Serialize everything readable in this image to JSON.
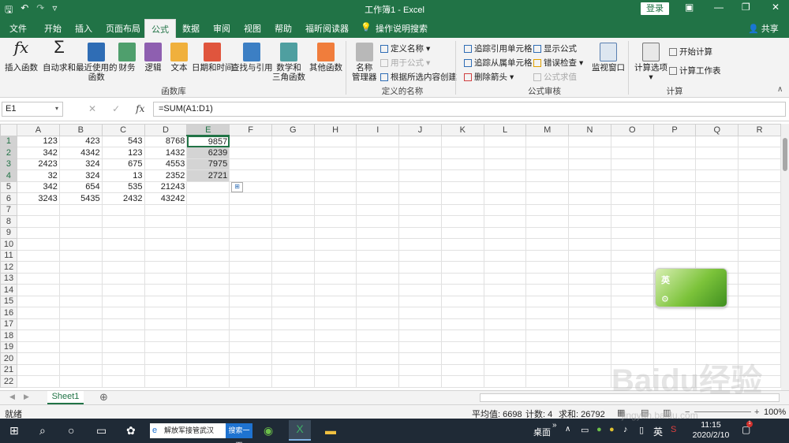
{
  "titlebar": {
    "title": "工作簿1  -  Excel",
    "login": "登录"
  },
  "tabs": [
    "文件",
    "开始",
    "插入",
    "页面布局",
    "公式",
    "数据",
    "审阅",
    "视图",
    "帮助",
    "福昕阅读器"
  ],
  "active_tab": "公式",
  "tellme": "操作说明搜索",
  "share": "共享",
  "ribbon": {
    "insert_function": "插入函数",
    "autosum": "自动求和",
    "recent": "最近使用的",
    "recent2": "函数",
    "financial": "财务",
    "logical": "逻辑",
    "text": "文本",
    "datetime": "日期和时间",
    "lookup": "查找与引用",
    "math1": "数学和",
    "math2": "三角函数",
    "other": "其他函数",
    "group_library": "函数库",
    "name_manager1": "名称",
    "name_manager2": "管理器",
    "define_name": "定义名称",
    "use_in_formula": "用于公式",
    "create_from_selection": "根据所选内容创建",
    "group_names": "定义的名称",
    "trace_precedents": "追踪引用单元格",
    "trace_dependents": "追踪从属单元格",
    "remove_arrows": "删除箭头",
    "show_formulas": "显示公式",
    "error_checking": "错误检查",
    "evaluate_formula": "公式求值",
    "watch_window": "监视窗口",
    "group_audit": "公式审核",
    "calc_options": "计算选项",
    "calc_now": "开始计算",
    "calc_sheet": "计算工作表",
    "group_calc": "计算"
  },
  "formula_bar": {
    "name_box": "E1",
    "formula": "=SUM(A1:D1)",
    "fx": "fx"
  },
  "columns": [
    "A",
    "B",
    "C",
    "D",
    "E",
    "F",
    "G",
    "H",
    "I",
    "J",
    "K",
    "L",
    "M",
    "N",
    "O",
    "P",
    "Q",
    "R"
  ],
  "rows": [
    [
      "123",
      "423",
      "543",
      "8768",
      "9857"
    ],
    [
      "342",
      "4342",
      "123",
      "1432",
      "6239"
    ],
    [
      "2423",
      "324",
      "675",
      "4553",
      "7975"
    ],
    [
      "32",
      "324",
      "13",
      "2352",
      "2721"
    ],
    [
      "342",
      "654",
      "535",
      "21243",
      ""
    ],
    [
      "3243",
      "5435",
      "2432",
      "43242",
      ""
    ]
  ],
  "row_count": 22,
  "sheet_tab": "Sheet1",
  "status": {
    "ready": "就绪",
    "average": "平均值: 6698",
    "count": "计数: 4",
    "sum": "求和: 26792",
    "zoom": "100%"
  },
  "taskbar": {
    "search_text": "解放军接管武汉",
    "search_button": "搜索一下",
    "desktop": "桌面",
    "ime": "英",
    "time": "11:15",
    "date": "2020/2/10"
  },
  "ime_widget": "英",
  "watermark": "Baidu经验",
  "watermark_url": "jingyan.baidu.com",
  "colors": {
    "excel_green": "#217346",
    "selection_gray": "#d4d4d4",
    "taskbar": "#1f2a36"
  }
}
